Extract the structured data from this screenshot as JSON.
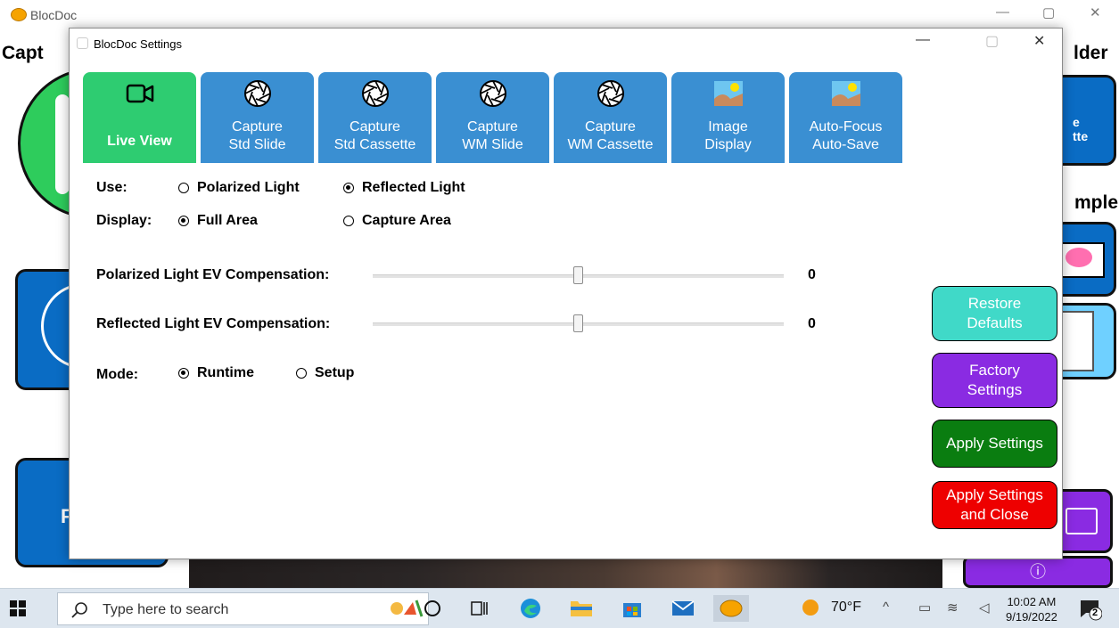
{
  "app": {
    "title": "BlocDoc",
    "heading_left": "Capt",
    "heading_right_1": "lder",
    "heading_right_2": "mple",
    "tile_right_fragment_1": "e",
    "tile_right_fragment_2": "tte",
    "tile_left_fragment": "F",
    "info_icon": "ⓘ"
  },
  "window_controls": {
    "minimize": "—",
    "maximize": "▢",
    "close": "✕"
  },
  "dialog": {
    "title": "BlocDoc Settings",
    "tabs": [
      {
        "label": "Live View",
        "icon": "video-camera-icon",
        "active": true
      },
      {
        "label": "Capture\nStd Slide",
        "icon": "aperture-icon",
        "active": false
      },
      {
        "label": "Capture\nStd Cassette",
        "icon": "aperture-icon",
        "active": false
      },
      {
        "label": "Capture\nWM Slide",
        "icon": "aperture-icon",
        "active": false
      },
      {
        "label": "Capture\nWM Cassette",
        "icon": "aperture-icon",
        "active": false
      },
      {
        "label": "Image\nDisplay",
        "icon": "picture-icon",
        "active": false
      },
      {
        "label": "Auto-Focus\nAuto-Save",
        "icon": "picture-icon",
        "active": false
      }
    ],
    "use": {
      "label": "Use:",
      "options": [
        {
          "label": "Polarized Light",
          "selected": false
        },
        {
          "label": "Reflected Light",
          "selected": true
        }
      ]
    },
    "display": {
      "label": "Display:",
      "options": [
        {
          "label": "Full Area",
          "selected": true
        },
        {
          "label": "Capture Area",
          "selected": false
        }
      ]
    },
    "polarized_ev": {
      "label": "Polarized Light EV Compensation:",
      "value": "0",
      "position": 0.5
    },
    "reflected_ev": {
      "label": "Reflected Light EV Compensation:",
      "value": "0",
      "position": 0.5
    },
    "mode": {
      "label": "Mode:",
      "options": [
        {
          "label": "Runtime",
          "selected": true
        },
        {
          "label": "Setup",
          "selected": false
        }
      ]
    },
    "buttons": {
      "restore": "Restore\nDefaults",
      "factory": "Factory\nSettings",
      "apply": "Apply Settings",
      "apply_close": "Apply Settings\nand Close"
    },
    "colors": {
      "restore": "#40d9c8",
      "factory": "#8a2be2",
      "apply": "#0a7d10",
      "apply_close": "#ee0000",
      "tab_active": "#2ecc71",
      "tab": "#3a8fd2"
    }
  },
  "taskbar": {
    "search_placeholder": "Type here to search",
    "weather": "70°F",
    "time": "10:02 AM",
    "date": "9/19/2022",
    "notifications": "2"
  }
}
